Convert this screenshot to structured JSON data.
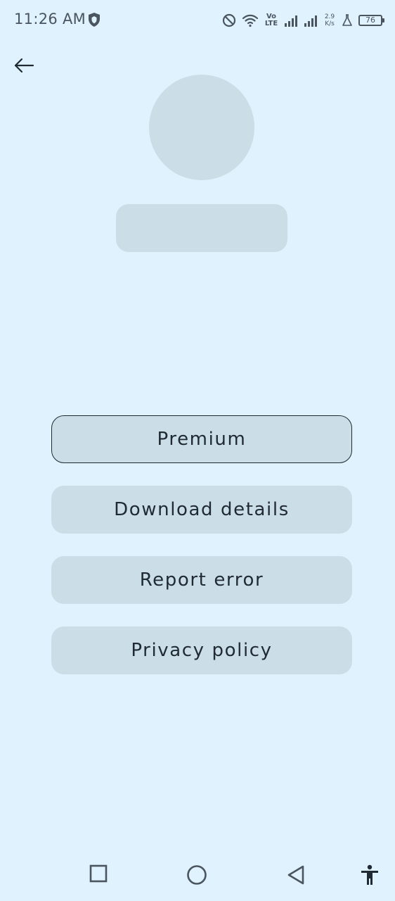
{
  "status_bar": {
    "time": "11:26 AM",
    "network_type": "Vo LTE",
    "net_speed_value": "2.9",
    "net_speed_unit": "K/s",
    "battery_level": "76"
  },
  "header": {
    "back_icon": "arrow-left-icon"
  },
  "profile": {
    "avatar_color": "#CBDDE6"
  },
  "menu": {
    "items": [
      {
        "label": "Premium",
        "selected": true
      },
      {
        "label": "Download details",
        "selected": false
      },
      {
        "label": "Report error",
        "selected": false
      },
      {
        "label": "Privacy policy",
        "selected": false
      }
    ]
  },
  "nav_bar": {
    "icons": [
      "square-icon",
      "circle-icon",
      "triangle-back-icon",
      "accessibility-icon"
    ]
  },
  "colors": {
    "background": "#DFF2FD",
    "placeholder": "#CBDDE6",
    "text": "#1F2A33",
    "status_icons": "#4B5560"
  }
}
